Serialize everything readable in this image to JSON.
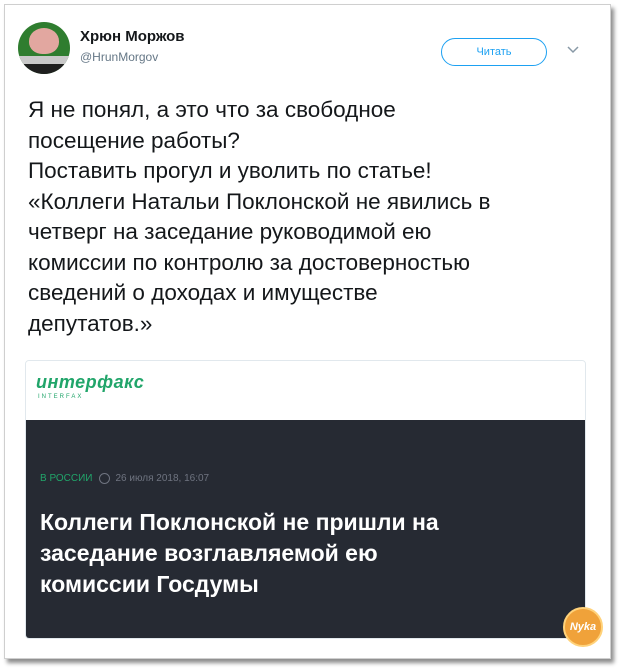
{
  "tweet": {
    "author_name": "Хрюн Моржов",
    "author_handle": "@HrunMorgov",
    "follow_label": "Читать",
    "text_lines": [
      "Я не понял, а это что за свободное",
      "посещение работы?",
      "Поставить прогул и уволить по статье!",
      "«Коллеги Натальи Поклонской не явились в",
      "четверг на заседание руководимой ею",
      "комиссии по контролю за достоверностью",
      "сведений о доходах и имуществе",
      "депутатов.»"
    ]
  },
  "card": {
    "logo": "интерфакс",
    "logo_sub": "INTERFAX",
    "category": "В РОССИИ",
    "date": "26 июля 2018, 16:07",
    "headline_lines": [
      "Коллеги Поклонской не пришли на",
      "заседание возглавляемой ею",
      "комиссии Госдумы"
    ]
  },
  "watermark": "Nyka",
  "colors": {
    "accent": "#1da1f2",
    "interfax_green": "#21a56a",
    "card_dark": "#262a33"
  }
}
